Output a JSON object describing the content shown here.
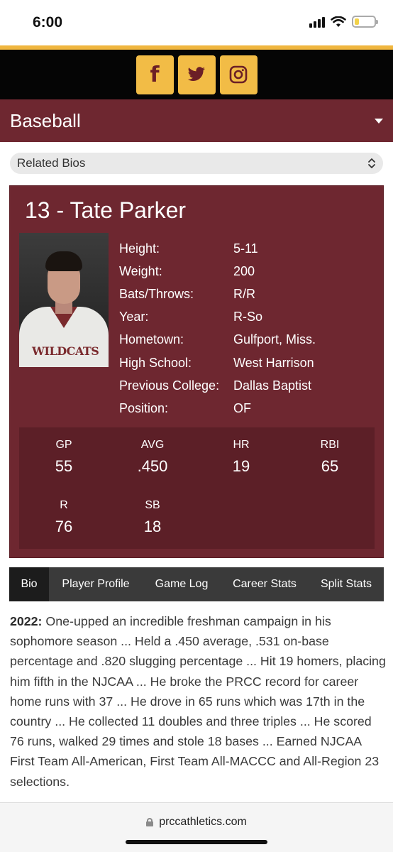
{
  "status_bar": {
    "time": "6:00"
  },
  "social": {
    "facebook_glyph": "f",
    "icons": [
      "facebook-icon",
      "twitter-icon",
      "instagram-icon"
    ],
    "button_color": "#f2bc46",
    "icon_color": "#6b1f26"
  },
  "sport": {
    "title": "Baseball"
  },
  "related": {
    "label": "Related Bios"
  },
  "player": {
    "name": "13 - Tate Parker",
    "photo_jersey_text": "WILDCATS",
    "info": [
      {
        "label": "Height:",
        "value": "5-11"
      },
      {
        "label": "Weight:",
        "value": "200"
      },
      {
        "label": "Bats/Throws:",
        "value": "R/R"
      },
      {
        "label": "Year:",
        "value": "R-So"
      },
      {
        "label": "Hometown:",
        "value": "Gulfport, Miss."
      },
      {
        "label": "High School:",
        "value": "West Harrison"
      },
      {
        "label": "Previous College:",
        "value": "Dallas Baptist"
      },
      {
        "label": "Position:",
        "value": "OF"
      }
    ],
    "stats": [
      {
        "label": "GP",
        "value": "55"
      },
      {
        "label": "AVG",
        "value": ".450"
      },
      {
        "label": "HR",
        "value": "19"
      },
      {
        "label": "RBI",
        "value": "65"
      },
      {
        "label": "R",
        "value": "76"
      },
      {
        "label": "SB",
        "value": "18"
      }
    ]
  },
  "tabs": [
    "Bio",
    "Player Profile",
    "Game Log",
    "Career Stats",
    "Split Stats"
  ],
  "bio": {
    "year": "2022:",
    "text": " One-upped an incredible freshman campaign in his sophomore season ... Held a .450 average, .531 on-base percentage and .820 slugging percentage ... Hit 19 homers, placing him fifth in the NJCAA ... He broke the PRCC record for career home runs with 37 ... He drove in 65 runs which was 17th in the country ... He collected 11 doubles and three triples ... He scored 76 runs, walked 29 times and stole 18 bases ... Earned NJCAA First Team All-American, First Team All-MACCC and All-Region 23 selections."
  },
  "browser": {
    "url": "prccathletics.com"
  },
  "colors": {
    "maroon": "#6e2730",
    "gold": "#f0b63f",
    "stats_bg": "#5c1f27"
  }
}
